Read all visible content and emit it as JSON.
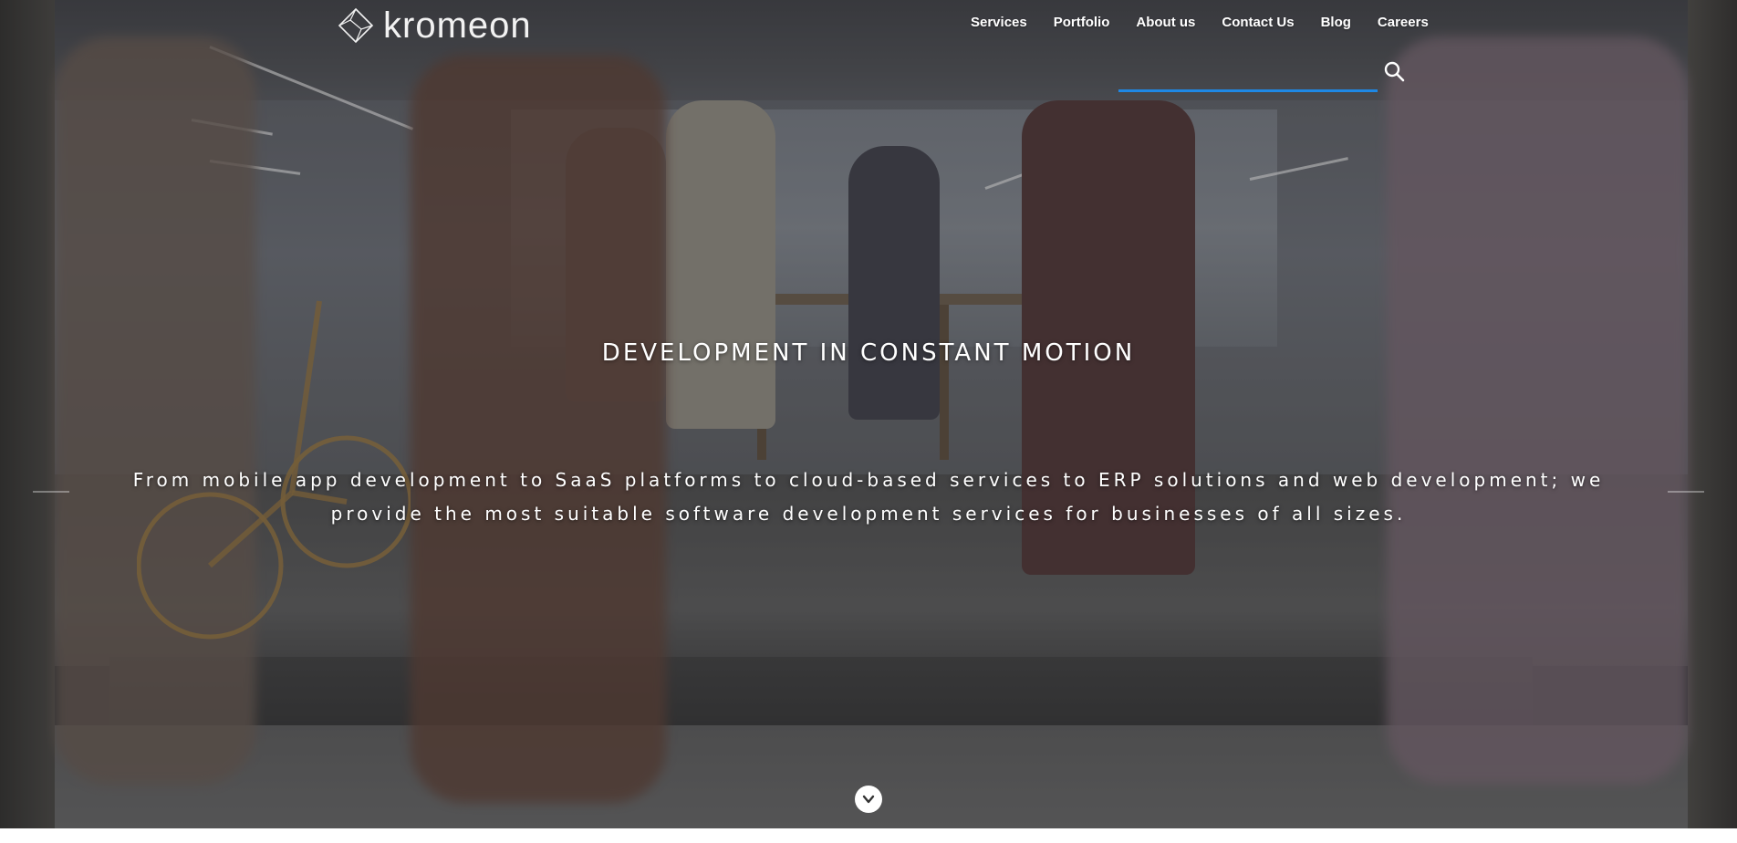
{
  "brand": {
    "name": "kromeon"
  },
  "nav": {
    "items": [
      {
        "label": "Services"
      },
      {
        "label": "Portfolio"
      },
      {
        "label": "About us"
      },
      {
        "label": "Contact Us"
      },
      {
        "label": "Blog"
      },
      {
        "label": "Careers"
      }
    ]
  },
  "search": {
    "value": "",
    "icon": "search-icon",
    "underline_color": "#1e88e5"
  },
  "hero": {
    "title": "DEVELOPMENT IN CONSTANT MOTION",
    "description_line1": "From mobile app development to SaaS platforms to cloud-based services to ERP solutions and web development; we",
    "description_line2": "provide the most suitable software development services for businesses of all sizes."
  },
  "scroll": {
    "icon": "chevron-down-icon"
  }
}
